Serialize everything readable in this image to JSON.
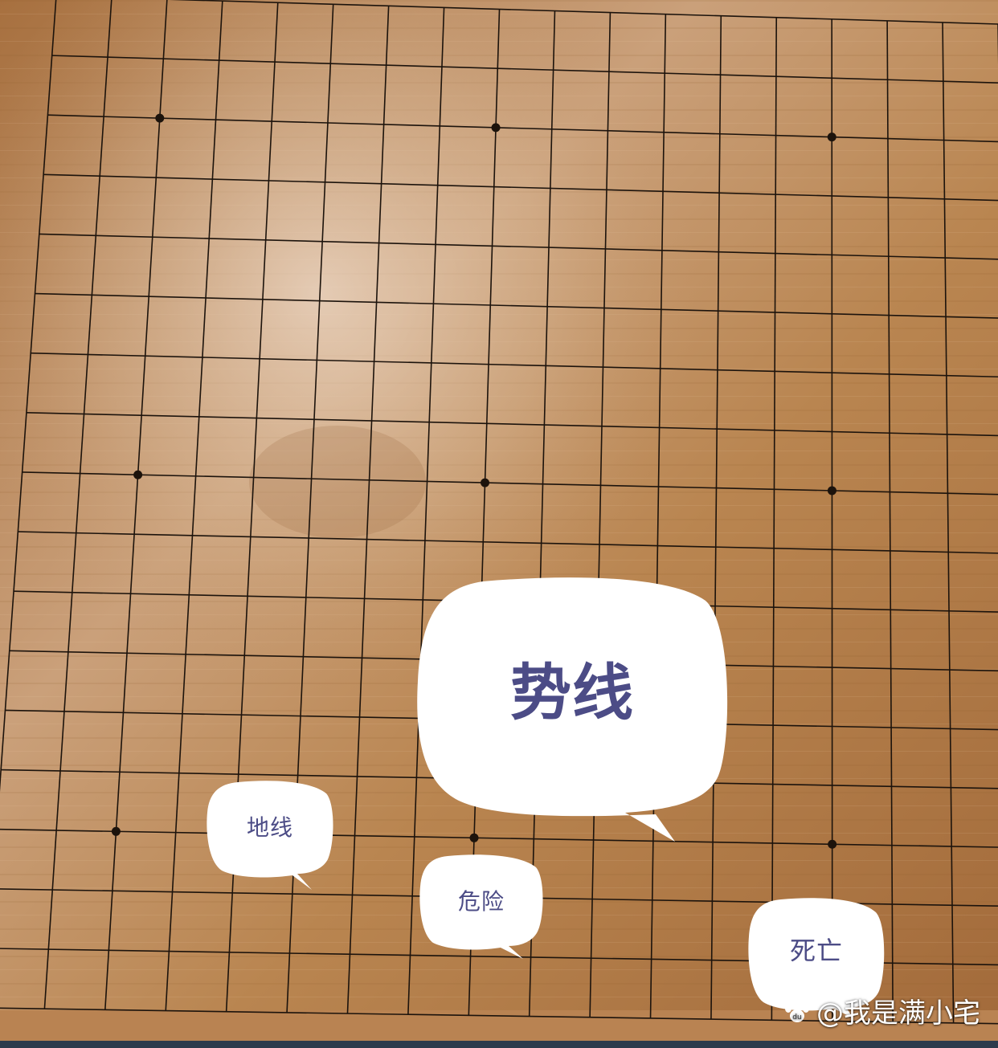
{
  "board": {
    "grid_lines": 19,
    "wood_color": "#b9804f",
    "line_color": "#1c130c",
    "star_points": "9"
  },
  "bubbles": {
    "shi_xian": "势线",
    "di_xian": "地线",
    "wei_xian": "危险",
    "si_wang": "死亡"
  },
  "colors": {
    "bubble_fill": "#ffffff",
    "bubble_text": "#4c4c86"
  },
  "watermark": {
    "icon": "baidu-paw-icon",
    "text": "@我是满小宅"
  }
}
